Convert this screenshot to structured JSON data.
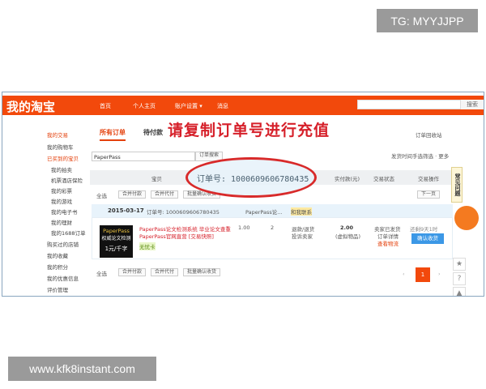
{
  "watermarks": {
    "top": "TG: MYYJJPP",
    "bottom": "www.kfk8instant.com"
  },
  "header": {
    "logo": "我的淘宝",
    "nav": [
      "首页",
      "个人主页",
      "账户设置 ▾",
      "消息"
    ],
    "search_button": "搜索",
    "search_value": ""
  },
  "sidebar": [
    {
      "label": "我的交易",
      "highlight": true
    },
    {
      "label": "我的购物车"
    },
    {
      "label": "已买到的宝贝",
      "highlight": true
    },
    {
      "label": "我的拍卖"
    },
    {
      "label": "机票酒店保险"
    },
    {
      "label": "我的彩票"
    },
    {
      "label": "我的游戏"
    },
    {
      "label": "我的电子书"
    },
    {
      "label": "我的理财"
    },
    {
      "label": "我的1688订单"
    },
    {
      "label": "购买过的店铺"
    },
    {
      "label": "我的收藏"
    },
    {
      "label": "我的积分"
    },
    {
      "label": "我的优惠信息"
    },
    {
      "label": "评价管理"
    }
  ],
  "tabs": [
    "所有订单",
    "待付款"
  ],
  "overlay": {
    "instruction": "请复制订单号进行充值",
    "order_number": "订单号: 1000609606780435"
  },
  "recycle": "订单回收站",
  "filter": {
    "search_value": "PaperPass",
    "search_button": "订单搜索",
    "note": "发货时间手选筛选 · 更多"
  },
  "table_headers": {
    "item": "宝贝",
    "paid": "实付款(元)",
    "status": "交易状态",
    "action": "交易操作"
  },
  "bulk": {
    "select_all": "全选",
    "merge_pay": "合并付款",
    "merge_proxy": "合并代付",
    "batch_confirm": "批量确认收货"
  },
  "pager_small": "下一页",
  "order": {
    "date": "2015-03-17",
    "order_label": "订单号: 1000609606780435",
    "shop": "PaperPass论...",
    "contact": "和我联系",
    "title_line1": "PaperPass论文检测系统 毕业论文查重",
    "title_line2": "PaperPass官网直营 [交易快照]",
    "badge": "无忧卡",
    "thumb_brand": "PaperPass",
    "thumb_line": "权威论文检测",
    "thumb_price": "1元/千字",
    "price": "1.00",
    "qty": "2",
    "refund": "退款/退货",
    "complain": "投诉卖家",
    "paid": "2.00",
    "paid_note": "(虚拟物品)",
    "status1": "卖家已发货",
    "status2": "订单详情",
    "status3": "查看物流",
    "remaining": "还剩9天1时",
    "confirm": "确认收货"
  },
  "pagination": {
    "prev": "‹",
    "current": "1",
    "next": "›"
  },
  "faq": "常见问题"
}
